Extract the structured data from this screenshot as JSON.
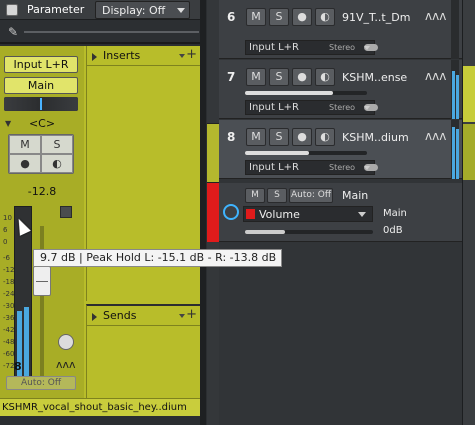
{
  "topbar": {
    "parameter_label": "Parameter",
    "display_label": "Display: Off"
  },
  "channel": {
    "input": "Input L+R",
    "output": "Main",
    "pan": "<C>",
    "mute_label": "M",
    "solo_label": "S",
    "fader_value": "-12.8",
    "scale": [
      "10",
      "6",
      "0",
      "-6",
      "-12",
      "-18",
      "-24",
      "-30",
      "-36",
      "-42",
      "-48",
      "-60",
      "-72"
    ],
    "number": "8",
    "auto_label": "Auto: Off",
    "inserts_title": "Inserts",
    "sends_title": "Sends",
    "name": "KSHMR_vocal_shout_basic_hey..dium"
  },
  "tracks": [
    {
      "number": "6",
      "m": "M",
      "s": "S",
      "name": "91V_T..t_Dm",
      "input": "Input L+R",
      "stereo": "Stereo"
    },
    {
      "number": "7",
      "m": "M",
      "s": "S",
      "name": "KSHM..ense",
      "input": "Input L+R",
      "stereo": "Stereo"
    },
    {
      "number": "8",
      "m": "M",
      "s": "S",
      "name": "KSHM..dium",
      "input": "Input L+R",
      "stereo": "Stereo"
    }
  ],
  "automation": {
    "m": "M",
    "s": "S",
    "mode": "Auto: Off",
    "target": "Main",
    "parameter": "Volume",
    "output": "Main",
    "value": "0dB"
  },
  "tooltip": {
    "text": "9.7 dB | Peak Hold L: -15.1 dB - R: -13.8 dB"
  },
  "colors": {
    "strip": "#b8bd2a",
    "accent": "#4ab3ff",
    "automation": "#e01b1b"
  }
}
